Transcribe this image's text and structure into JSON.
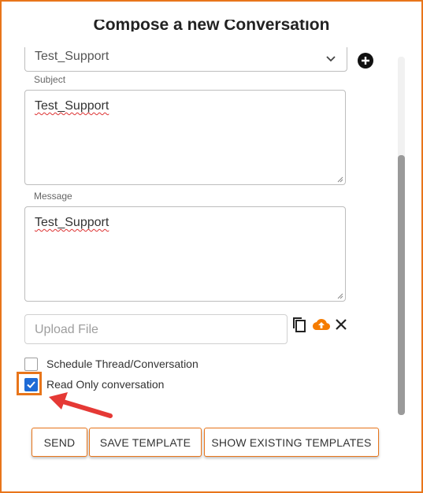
{
  "dialog": {
    "title": "Compose a new Conversation"
  },
  "recipient_select": {
    "value": "Test_Support"
  },
  "subject": {
    "label": "Subject",
    "value": "Test_Support"
  },
  "message": {
    "label": "Message",
    "value": "Test_Support"
  },
  "upload": {
    "placeholder": "Upload File"
  },
  "options": {
    "schedule": {
      "label": "Schedule Thread/Conversation",
      "checked": false
    },
    "read_only": {
      "label": "Read Only conversation",
      "checked": true
    }
  },
  "actions": {
    "send_label": "SEND",
    "save_template_label": "SAVE TEMPLATE",
    "show_templates_label": "SHOW EXISTING TEMPLATES"
  },
  "icons": {
    "add": "plus-circle-icon",
    "copy": "copy-icon",
    "upload": "cloud-upload-icon",
    "clear": "close-icon",
    "dropdown": "chevron-down-icon",
    "annotation": "red-arrow"
  },
  "colors": {
    "accent": "#e8751a",
    "checkbox_checked": "#1e6bd6",
    "upload_icon": "#f57c00",
    "annotation_arrow": "#e53935"
  }
}
